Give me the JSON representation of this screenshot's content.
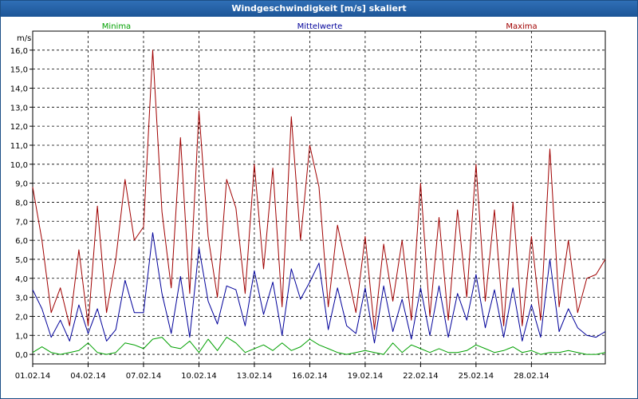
{
  "window": {
    "title": "Windgeschwindigkeit [m/s] skaliert"
  },
  "chart_data": {
    "type": "line",
    "title": "Windgeschwindigkeit [m/s] skaliert",
    "ylabel": "m/s",
    "xlabel": "",
    "ylim": [
      -0.5,
      17.0
    ],
    "xlim": [
      0,
      31
    ],
    "x_unit": "days since 01.02.14 00:00",
    "x_tick_labels": [
      "01.02.14",
      "04.02.14",
      "07.02.14",
      "10.02.14",
      "13.02.14",
      "16.02.14",
      "19.02.14",
      "22.02.14",
      "25.02.14",
      "28.02.14"
    ],
    "x_tick_values": [
      0,
      3,
      6,
      9,
      12,
      15,
      18,
      21,
      24,
      27
    ],
    "y_tick_labels": [
      "0,0",
      "1,0",
      "2,0",
      "3,0",
      "4,0",
      "5,0",
      "6,0",
      "7,0",
      "8,0",
      "9,0",
      "10,0",
      "11,0",
      "12,0",
      "13,0",
      "14,0",
      "15,0",
      "16,0"
    ],
    "y_tick_values": [
      0,
      1,
      2,
      3,
      4,
      5,
      6,
      7,
      8,
      9,
      10,
      11,
      12,
      13,
      14,
      15,
      16
    ],
    "grid": true,
    "legend_placement": "top",
    "series": [
      {
        "name": "Minima",
        "color": "#00a000",
        "x": [
          0,
          0.5,
          1,
          1.5,
          2,
          2.5,
          3,
          3.5,
          4,
          4.5,
          5,
          5.5,
          6,
          6.5,
          7,
          7.5,
          8,
          8.5,
          9,
          9.5,
          10,
          10.5,
          11,
          11.5,
          12,
          12.5,
          13,
          13.5,
          14,
          14.5,
          15,
          15.5,
          16,
          16.5,
          17,
          17.5,
          18,
          18.5,
          19,
          19.5,
          20,
          20.5,
          21,
          21.5,
          22,
          22.5,
          23,
          23.5,
          24,
          24.5,
          25,
          25.5,
          26,
          26.5,
          27,
          27.5,
          28,
          28.5,
          29,
          29.5,
          30,
          30.5,
          31
        ],
        "values": [
          0.1,
          0.4,
          0.1,
          0.0,
          0.1,
          0.2,
          0.6,
          0.1,
          0.0,
          0.1,
          0.6,
          0.5,
          0.3,
          0.8,
          0.9,
          0.4,
          0.3,
          0.7,
          0.1,
          0.8,
          0.2,
          0.9,
          0.6,
          0.1,
          0.3,
          0.5,
          0.2,
          0.6,
          0.2,
          0.4,
          0.8,
          0.5,
          0.3,
          0.1,
          0.0,
          0.1,
          0.2,
          0.1,
          0.0,
          0.6,
          0.1,
          0.5,
          0.3,
          0.1,
          0.3,
          0.1,
          0.1,
          0.2,
          0.5,
          0.3,
          0.1,
          0.2,
          0.4,
          0.1,
          0.2,
          0.0,
          0.1,
          0.1,
          0.2,
          0.1,
          0.0,
          0.0,
          0.1
        ]
      },
      {
        "name": "Mittelwerte",
        "color": "#00009a",
        "x": [
          0,
          0.5,
          1,
          1.5,
          2,
          2.5,
          3,
          3.5,
          4,
          4.5,
          5,
          5.5,
          6,
          6.5,
          7,
          7.5,
          8,
          8.5,
          9,
          9.5,
          10,
          10.5,
          11,
          11.5,
          12,
          12.5,
          13,
          13.5,
          14,
          14.5,
          15,
          15.5,
          16,
          16.5,
          17,
          17.5,
          18,
          18.5,
          19,
          19.5,
          20,
          20.5,
          21,
          21.5,
          22,
          22.5,
          23,
          23.5,
          24,
          24.5,
          25,
          25.5,
          26,
          26.5,
          27,
          27.5,
          28,
          28.5,
          29,
          29.5,
          30,
          30.5,
          31
        ],
        "values": [
          3.4,
          2.4,
          0.9,
          1.8,
          0.7,
          2.6,
          1.1,
          2.4,
          0.7,
          1.3,
          3.9,
          2.2,
          2.2,
          6.4,
          3.2,
          1.1,
          4.1,
          0.9,
          5.6,
          2.8,
          1.6,
          3.6,
          3.4,
          1.5,
          4.4,
          2.1,
          3.8,
          1.0,
          4.5,
          2.9,
          3.8,
          4.8,
          1.3,
          3.5,
          1.5,
          1.1,
          3.5,
          0.6,
          3.6,
          1.2,
          2.9,
          0.8,
          3.5,
          1.0,
          3.6,
          0.9,
          3.2,
          1.8,
          4.2,
          1.4,
          3.4,
          0.9,
          3.5,
          0.7,
          2.6,
          0.9,
          5.0,
          1.2,
          2.4,
          1.4,
          1.0,
          0.9,
          1.2
        ]
      },
      {
        "name": "Maxima",
        "color": "#a00000",
        "x": [
          0,
          0.5,
          1,
          1.5,
          2,
          2.5,
          3,
          3.5,
          4,
          4.5,
          5,
          5.5,
          6,
          6.5,
          7,
          7.5,
          8,
          8.5,
          9,
          9.5,
          10,
          10.5,
          11,
          11.5,
          12,
          12.5,
          13,
          13.5,
          14,
          14.5,
          15,
          15.5,
          16,
          16.5,
          17,
          17.5,
          18,
          18.5,
          19,
          19.5,
          20,
          20.5,
          21,
          21.5,
          22,
          22.5,
          23,
          23.5,
          24,
          24.5,
          25,
          25.5,
          26,
          26.5,
          27,
          27.5,
          28,
          28.5,
          29,
          29.5,
          30,
          30.5,
          31
        ],
        "values": [
          8.8,
          6.0,
          2.2,
          3.5,
          1.5,
          5.5,
          1.5,
          7.8,
          2.2,
          5.0,
          9.2,
          6.0,
          6.7,
          16.0,
          7.5,
          3.5,
          11.4,
          3.2,
          12.8,
          6.2,
          3.0,
          9.2,
          7.7,
          3.2,
          10.0,
          4.5,
          9.8,
          2.5,
          12.5,
          6.0,
          11.0,
          8.8,
          2.5,
          6.8,
          4.5,
          2.2,
          6.2,
          1.3,
          5.8,
          2.8,
          6.0,
          1.8,
          9.0,
          2.0,
          7.2,
          1.8,
          7.6,
          3.0,
          10.0,
          2.8,
          7.6,
          1.5,
          8.0,
          1.5,
          6.2,
          1.8,
          10.8,
          2.5,
          6.0,
          2.2,
          4.0,
          4.2,
          5.0
        ]
      }
    ]
  }
}
